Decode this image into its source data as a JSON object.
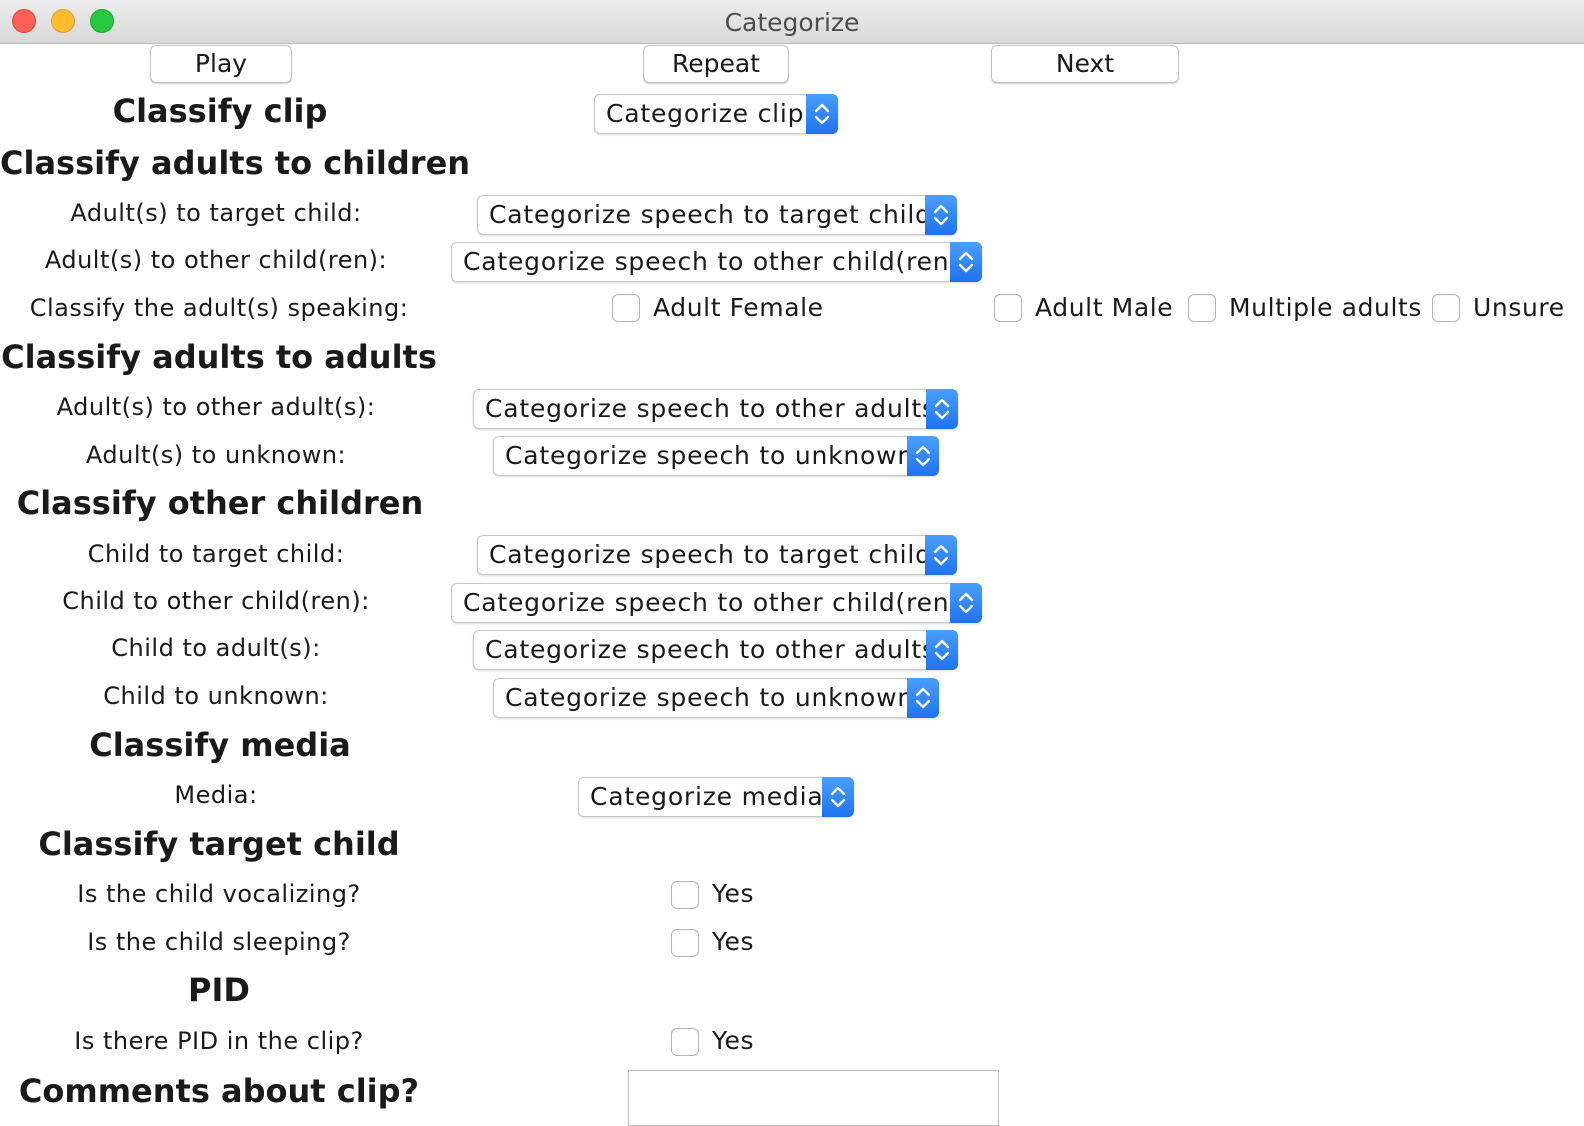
{
  "window": {
    "title": "Categorize"
  },
  "toolbar": {
    "play_label": "Play",
    "repeat_label": "Repeat",
    "next_label": "Next"
  },
  "clip": {
    "heading": "Classify clip",
    "select_value": "Categorize clip"
  },
  "adults_to_children": {
    "heading": "Classify adults to children",
    "target_child_label": "Adult(s) to target child:",
    "target_child_value": "Categorize speech to target child",
    "other_children_label": "Adult(s) to other child(ren):",
    "other_children_value": "Categorize speech to other child(ren)",
    "speaker_label": "Classify the adult(s) speaking:",
    "speaker_options": {
      "female": "Adult Female",
      "male": "Adult Male",
      "multiple": "Multiple adults",
      "unsure": "Unsure"
    }
  },
  "adults_to_adults": {
    "heading": "Classify adults to adults",
    "other_adults_label": "Adult(s) to other adult(s):",
    "other_adults_value": "Categorize speech to other adults",
    "unknown_label": "Adult(s) to unknown:",
    "unknown_value": "Categorize speech to unknown"
  },
  "other_children": {
    "heading": "Classify other children",
    "target_child_label": "Child to target child:",
    "target_child_value": "Categorize speech to target child",
    "other_children_label": "Child to other child(ren):",
    "other_children_value": "Categorize speech to other child(ren)",
    "adults_label": "Child to adult(s):",
    "adults_value": "Categorize speech to other adults",
    "unknown_label": "Child to unknown:",
    "unknown_value": "Categorize speech to unknown"
  },
  "media": {
    "heading": "Classify media",
    "label": "Media:",
    "select_value": "Categorize media"
  },
  "target_child": {
    "heading": "Classify target child",
    "vocalizing_label": "Is the child vocalizing?",
    "vocalizing_option": "Yes",
    "sleeping_label": "Is the child sleeping?",
    "sleeping_option": "Yes"
  },
  "pid": {
    "heading": "PID",
    "label": "Is there PID in the clip?",
    "option": "Yes"
  },
  "comments": {
    "heading": "Comments about clip?",
    "value": ""
  },
  "colors": {
    "accent": "#2a7cf5",
    "close": "#fe5f57",
    "minimize": "#febc2e",
    "zoom": "#28c840"
  }
}
